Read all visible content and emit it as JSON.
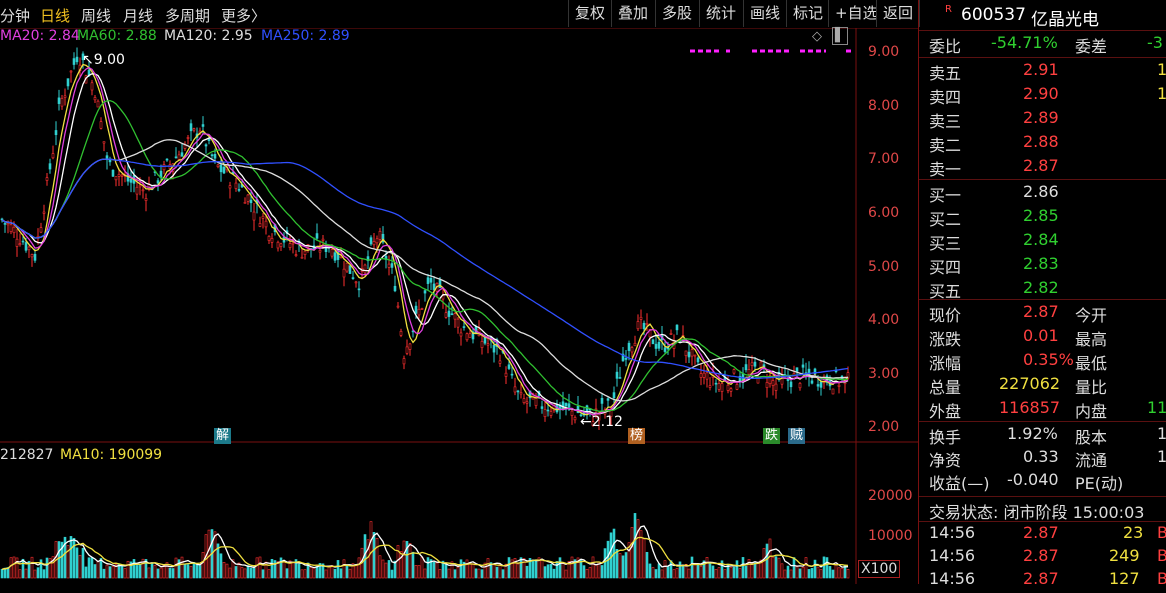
{
  "toolbar": {
    "left": [
      "分钟",
      "日线",
      "周线",
      "月线",
      "多周期",
      "更多〉"
    ],
    "right": [
      "复权",
      "叠加",
      "多股",
      "统计",
      "画线",
      "标记",
      "+自选",
      "返回"
    ]
  },
  "ma_legend": [
    {
      "label": "MA20: 2.84",
      "color": "#e040e0"
    },
    {
      "label": "MA60: 2.88",
      "color": "#30c030"
    },
    {
      "label": "MA120: 2.95",
      "color": "#dddddd"
    },
    {
      "label": "MA250: 2.89",
      "color": "#3050ff"
    }
  ],
  "vol_legend": [
    {
      "label": "212827",
      "color": "#dddddd"
    },
    {
      "label": "MA10: 190099",
      "color": "#f0e040"
    }
  ],
  "price_axis": [
    "9.00",
    "8.00",
    "7.00",
    "6.00",
    "5.00",
    "4.00",
    "3.00",
    "2.00"
  ],
  "volume_axis": [
    "20000",
    "10000"
  ],
  "volume_unit": "X100",
  "annotations": {
    "high": "9.00",
    "low": "2.12"
  },
  "markers": [
    {
      "text": "解",
      "bg": "#1c7a8a",
      "color": "#fff"
    },
    {
      "text": "榜",
      "bg": "#b06020",
      "color": "#fff"
    },
    {
      "text": "跌",
      "bg": "#2a8a2a",
      "color": "#fff"
    },
    {
      "text": "贼",
      "bg": "#2a6a8a",
      "color": "#fff"
    }
  ],
  "stock": {
    "badge": "R",
    "code": "600537",
    "name": "亿晶光电"
  },
  "weibi": {
    "label": "委比",
    "value": "-54.71%",
    "label2": "委差",
    "value2": "-3"
  },
  "asks": [
    {
      "label": "卖五",
      "price": "2.91",
      "vol": "1"
    },
    {
      "label": "卖四",
      "price": "2.90",
      "vol": "1"
    },
    {
      "label": "卖三",
      "price": "2.89",
      "vol": ""
    },
    {
      "label": "卖二",
      "price": "2.88",
      "vol": ""
    },
    {
      "label": "卖一",
      "price": "2.87",
      "vol": ""
    }
  ],
  "bids": [
    {
      "label": "买一",
      "price": "2.86",
      "color": "#dddddd"
    },
    {
      "label": "买二",
      "price": "2.85",
      "color": "#30d030"
    },
    {
      "label": "买三",
      "price": "2.84",
      "color": "#30d030"
    },
    {
      "label": "买四",
      "price": "2.83",
      "color": "#30d030"
    },
    {
      "label": "买五",
      "price": "2.82",
      "color": "#30d030"
    }
  ],
  "quote": [
    {
      "l1": "现价",
      "v1": "2.87",
      "c1": "#ff4040",
      "l2": "今开",
      "v2": ""
    },
    {
      "l1": "涨跌",
      "v1": "0.01",
      "c1": "#ff4040",
      "l2": "最高",
      "v2": ""
    },
    {
      "l1": "涨幅",
      "v1": "0.35%",
      "c1": "#ff4040",
      "l2": "最低",
      "v2": ""
    },
    {
      "l1": "总量",
      "v1": "227062",
      "c1": "#f0e040",
      "l2": "量比",
      "v2": ""
    },
    {
      "l1": "外盘",
      "v1": "116857",
      "c1": "#ff4040",
      "l2": "内盘",
      "v2": "11"
    }
  ],
  "fund": [
    {
      "l1": "换手",
      "v1": "1.92%",
      "l2": "股本",
      "v2": "1"
    },
    {
      "l1": "净资",
      "v1": "0.33",
      "l2": "流通",
      "v2": "1"
    },
    {
      "l1": "收益(—)",
      "v1": "-0.040",
      "l2": "PE(动)",
      "v2": ""
    }
  ],
  "trade_status": "交易状态: 闭市阶段 15:00:03",
  "ticks": [
    {
      "time": "14:56",
      "price": "2.87",
      "vol": "23",
      "vc": "#f0e040",
      "side": "B"
    },
    {
      "time": "14:56",
      "price": "2.87",
      "vol": "249",
      "vc": "#f0e040",
      "side": "B"
    },
    {
      "time": "14:56",
      "price": "2.87",
      "vol": "127",
      "vc": "#f0e040",
      "side": "B"
    }
  ]
}
